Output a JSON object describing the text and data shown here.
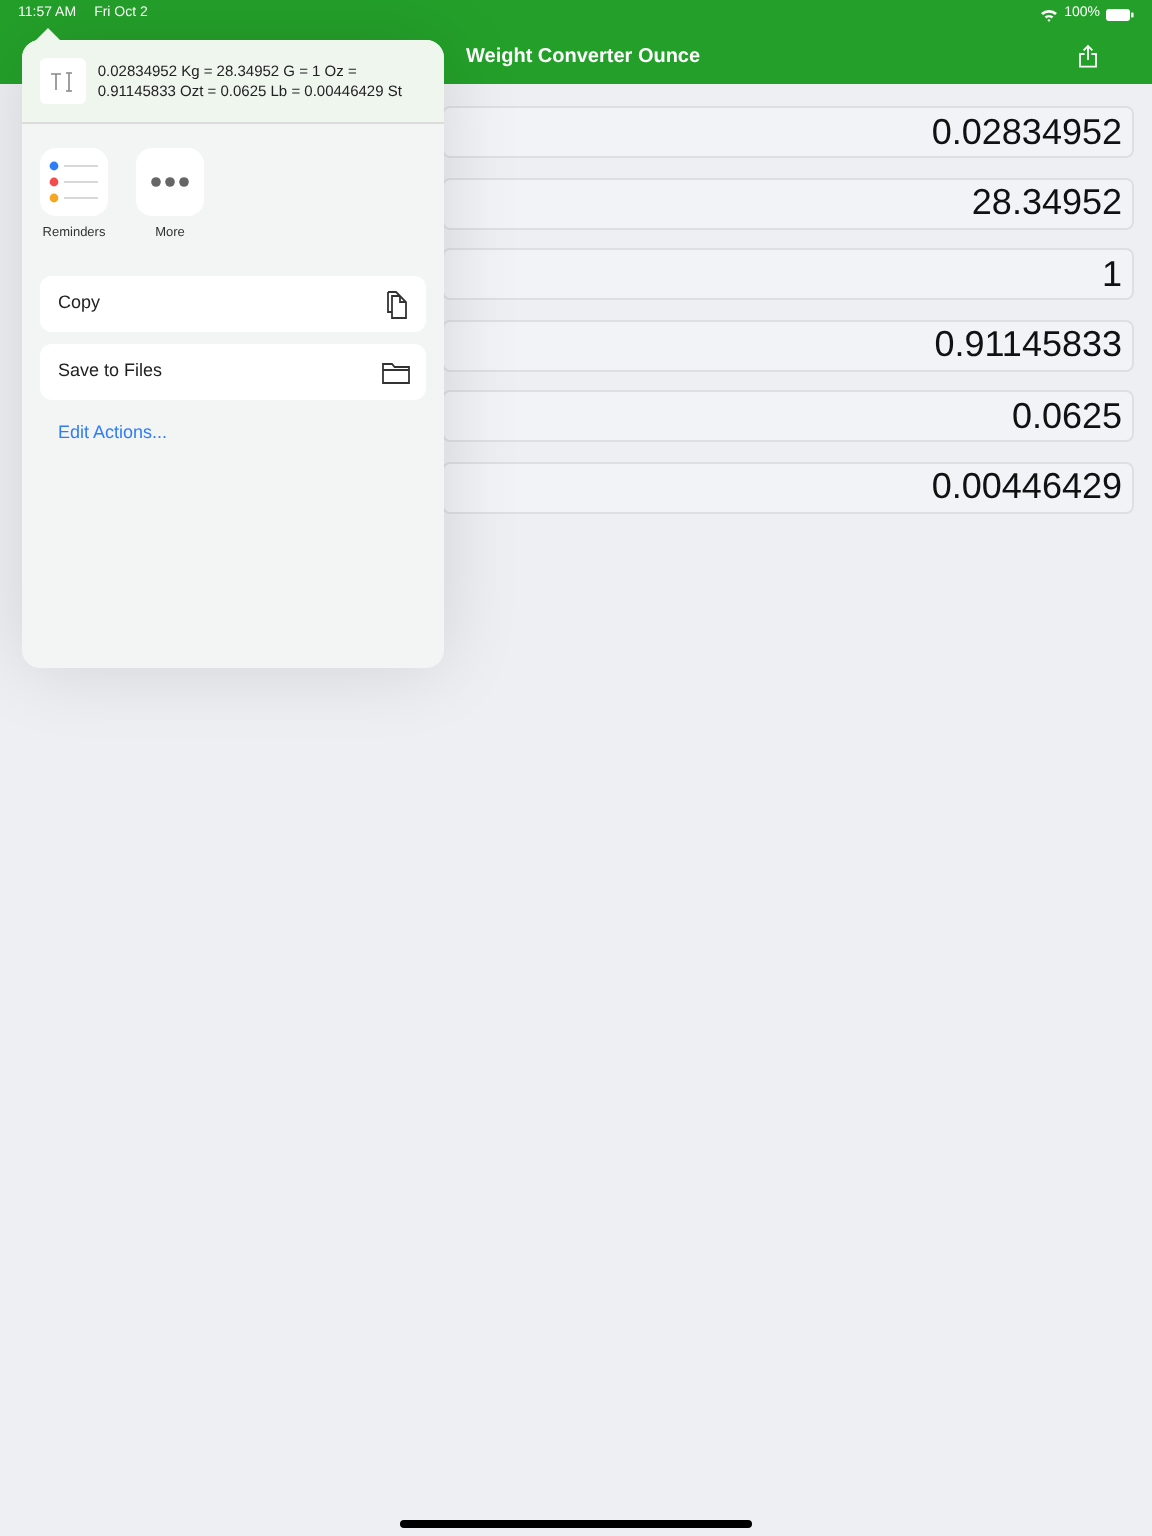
{
  "status_bar": {
    "time": "11:57 AM",
    "date": "Fri Oct 2",
    "battery": "100%"
  },
  "nav_bar": {
    "title": "Weight Converter Ounce"
  },
  "rows": [
    {
      "value": "0.02834952"
    },
    {
      "value": "28.34952"
    },
    {
      "value": "1"
    },
    {
      "value": "0.91145833"
    },
    {
      "value": "0.0625"
    },
    {
      "value": "0.00446429"
    }
  ],
  "share_sheet": {
    "preview_text": "0.02834952 Kg = 28.34952 G = 1 Oz = 0.91145833 Ozt = 0.0625 Lb = 0.00446429 St",
    "apps": [
      {
        "kind": "reminders",
        "label": "Reminders"
      },
      {
        "kind": "more",
        "label": "More"
      }
    ],
    "actions": [
      {
        "kind": "copy",
        "label": "Copy"
      },
      {
        "kind": "files",
        "label": "Save to Files"
      }
    ],
    "edit_link": "Edit Actions..."
  }
}
